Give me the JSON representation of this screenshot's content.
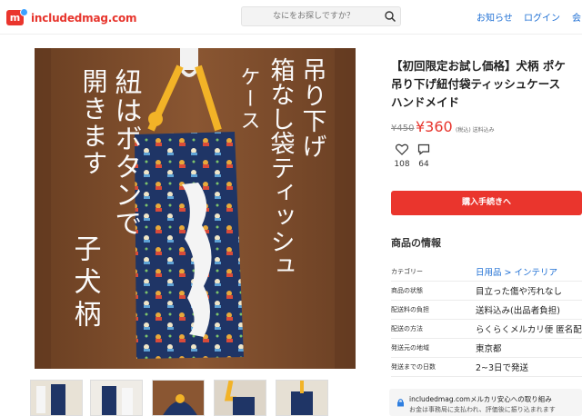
{
  "header": {
    "logo_letter": "m",
    "brand": "includedmag.com",
    "search_placeholder": "なにをお探しですか？",
    "nav": [
      "お知らせ",
      "ログイン",
      "会"
    ]
  },
  "hero": {
    "texts": {
      "col1": "紐はボタンで",
      "col2": "開きます",
      "col3": "子犬柄",
      "top1": "吊り下げ",
      "top2": "箱なし袋ティッシュ",
      "top3": "ケース"
    }
  },
  "product": {
    "title_lines": [
      "【初回限定お試し価格】犬柄 ポケ",
      "吊り下げ紐付袋ティッシュケース",
      "ハンドメイド"
    ],
    "old_price": "¥450",
    "price": "¥360",
    "tax_note": "(税込) 送料込み",
    "likes": "108",
    "comments": "64",
    "buy_label": "購入手続きへ"
  },
  "info": {
    "section_title": "商品の情報",
    "rows": [
      {
        "label": "カテゴリー",
        "value": "日用品 > インテリア"
      },
      {
        "label": "商品の状態",
        "value": "目立った傷や汚れなし"
      },
      {
        "label": "配送料の負担",
        "value": "送料込み(出品者負担)"
      },
      {
        "label": "配送の方法",
        "value": "らくらくメルカリ便 匿名配"
      },
      {
        "label": "発送元の地域",
        "value": "東京都"
      },
      {
        "label": "発送までの日数",
        "value": "2~3日で発送"
      }
    ]
  },
  "notice": {
    "line1": "includedmag.comメルカリ安心への取り組み",
    "line2": "お金は事務局に支払われ、評価後に振り込まれます"
  },
  "colors": {
    "brand_red": "#ea352d",
    "link_blue": "#1e6fd4",
    "door_brown": "#7a4b2a",
    "fabric_navy": "#1f3566",
    "strap_yellow": "#f2b327"
  }
}
